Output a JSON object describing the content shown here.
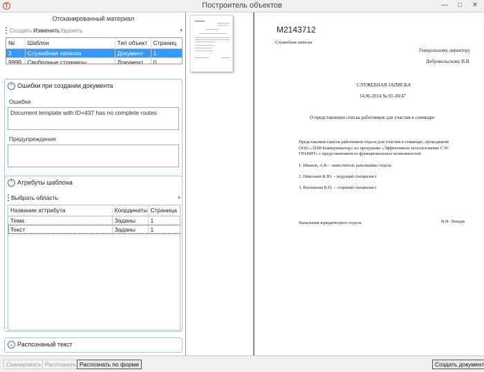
{
  "window": {
    "title": "Построитель объектов",
    "app_icon_glyph": "Т"
  },
  "scanned": {
    "title": "Отсканированный материал",
    "toolbar": {
      "create": "Создать",
      "change": "Изменить",
      "delete": "Удалить"
    },
    "columns": [
      "№",
      "Шаблон",
      "Тип объект",
      "Страниц"
    ],
    "rows": [
      {
        "num": "3",
        "template": "Служебная записка",
        "type": "Документ",
        "pages": "1",
        "selected": true
      },
      {
        "num": "9999",
        "template": "Свободные страницы",
        "type": "Документ",
        "pages": "0",
        "selected": false
      }
    ]
  },
  "errors_group": {
    "header": "Ошибки при создании документа",
    "errors_label": "Ошибки",
    "errors_text": "Document template with ID=437 has no complete routes",
    "warnings_label": "Предупреждения",
    "warnings_text": ""
  },
  "attrs_group": {
    "header": "Атрибуты шаблона",
    "select_area": "Выбрать область",
    "columns": [
      "Название аттрибута",
      "Координаты",
      "Страница"
    ],
    "rows": [
      {
        "name": "Тема",
        "coords": "Заданы",
        "page": "1"
      },
      {
        "name": "Текст",
        "coords": "Заданы",
        "page": "1"
      }
    ]
  },
  "recognized_group": {
    "header": "Распознаный текст"
  },
  "document": {
    "code": "M2143712",
    "doc_type": "Служебная записка",
    "to_line1": "Генеральному директору",
    "to_line2": "Добровольскому В.В.",
    "heading": "СЛУЖЕБНАЯ ЗАПИСКА",
    "date_num": "14.06.2014 № 01-20/47",
    "subject": "О представлении списка работников для участия в семинаре",
    "body1": "Представляем список работников отдела для участия в семинаре, проводимом",
    "body2": "ООО «АПИ Коммуникатор» по программе «Эффективное использование СЭС",
    "body3": "ГРАНИТ» с представлением ее функциональных возможностей:",
    "item1": "1. Иванов, А.В.– заместитель начальника отдела",
    "item2": "2. Николаев К.Ю. – ведущий специалист",
    "item3": "3. Васильева К.П. – старший специалист",
    "sign_left": "Начальник юридического отдела",
    "sign_right": "В.Н. Левцов"
  },
  "bottom": {
    "scan": "Сканировать",
    "recognize": "Распознать",
    "recognize_form": "Распознать по форме",
    "create_doc": "Создать документ"
  },
  "colors": {
    "selection": "#3399ff",
    "group_border": "#9cc9e6"
  }
}
